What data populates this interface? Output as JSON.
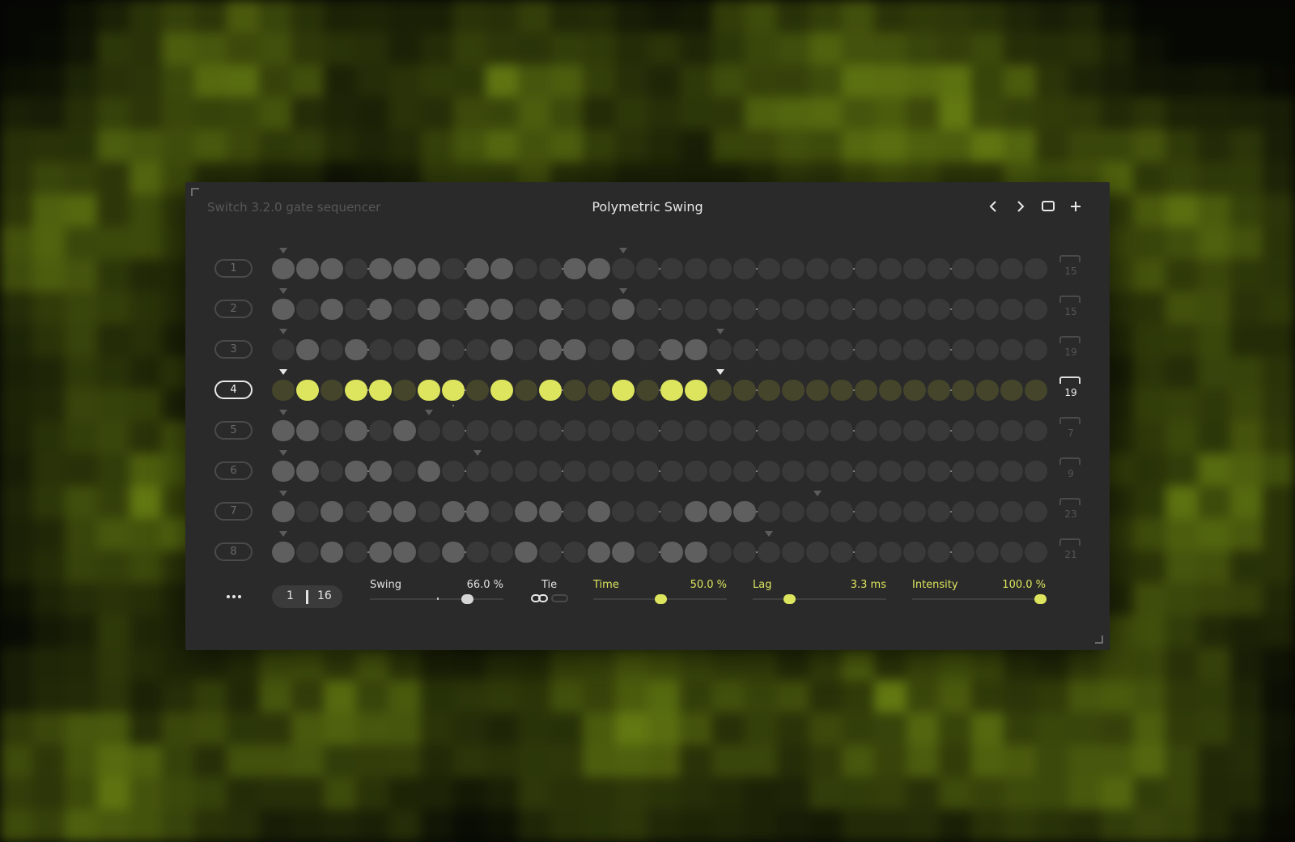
{
  "app": {
    "title": "Switch 3.2.0 gate sequencer",
    "preset_name": "Polymetric Swing"
  },
  "toolbar": {
    "icons": [
      "chevron-left-icon",
      "chevron-right-icon",
      "square-icon",
      "plus-icon"
    ]
  },
  "colors": {
    "accent": "#dde55e",
    "accent_dim": "#45452c",
    "step_on": "#5f5f5f",
    "step_off": "#393939",
    "panel": "#2a2a2a"
  },
  "tracks": [
    {
      "label": "1",
      "length_label": "15",
      "active": false,
      "steps": "111011101100110000000000000000000000000000000000000000000000000",
      "markers": [
        0,
        14
      ]
    },
    {
      "label": "2",
      "length_label": "15",
      "active": false,
      "steps": "1010101011010010000000000000000",
      "markers": [
        0,
        14
      ]
    },
    {
      "label": "3",
      "length_label": "19",
      "active": false,
      "steps": "0101001001011010110000000000000",
      "markers": [
        0,
        18
      ]
    },
    {
      "label": "4",
      "length_label": "19",
      "active": true,
      "steps": "0101101101010010110000000000000",
      "markers": [
        0,
        18
      ]
    },
    {
      "label": "5",
      "length_label": "7",
      "active": false,
      "steps": "1101010000000000000000000000000",
      "markers": [
        0,
        6
      ]
    },
    {
      "label": "6",
      "length_label": "9",
      "active": false,
      "steps": "1101101000000000000000000000000",
      "markers": [
        0,
        8
      ]
    },
    {
      "label": "7",
      "length_label": "23",
      "active": false,
      "steps": "1010110110110100011100000000000",
      "markers": [
        0,
        22
      ]
    },
    {
      "label": "8",
      "length_label": "21",
      "active": false,
      "steps": "1010110100100110110000000000000",
      "markers": [
        0,
        20
      ]
    }
  ],
  "pager": {
    "current": "1",
    "total": "16"
  },
  "swing": {
    "label": "Swing",
    "value": "66.0 %",
    "level": 0.75,
    "default_level": 0.5
  },
  "tie": {
    "label": "Tie",
    "icon": "link-icon"
  },
  "time": {
    "label": "Time",
    "value": "50.0 %",
    "level": 0.5
  },
  "lag": {
    "label": "Lag",
    "value": "3.3 ms",
    "level": 0.25
  },
  "intensity": {
    "label": "Intensity",
    "value": "100.0 %",
    "level": 1.0
  }
}
